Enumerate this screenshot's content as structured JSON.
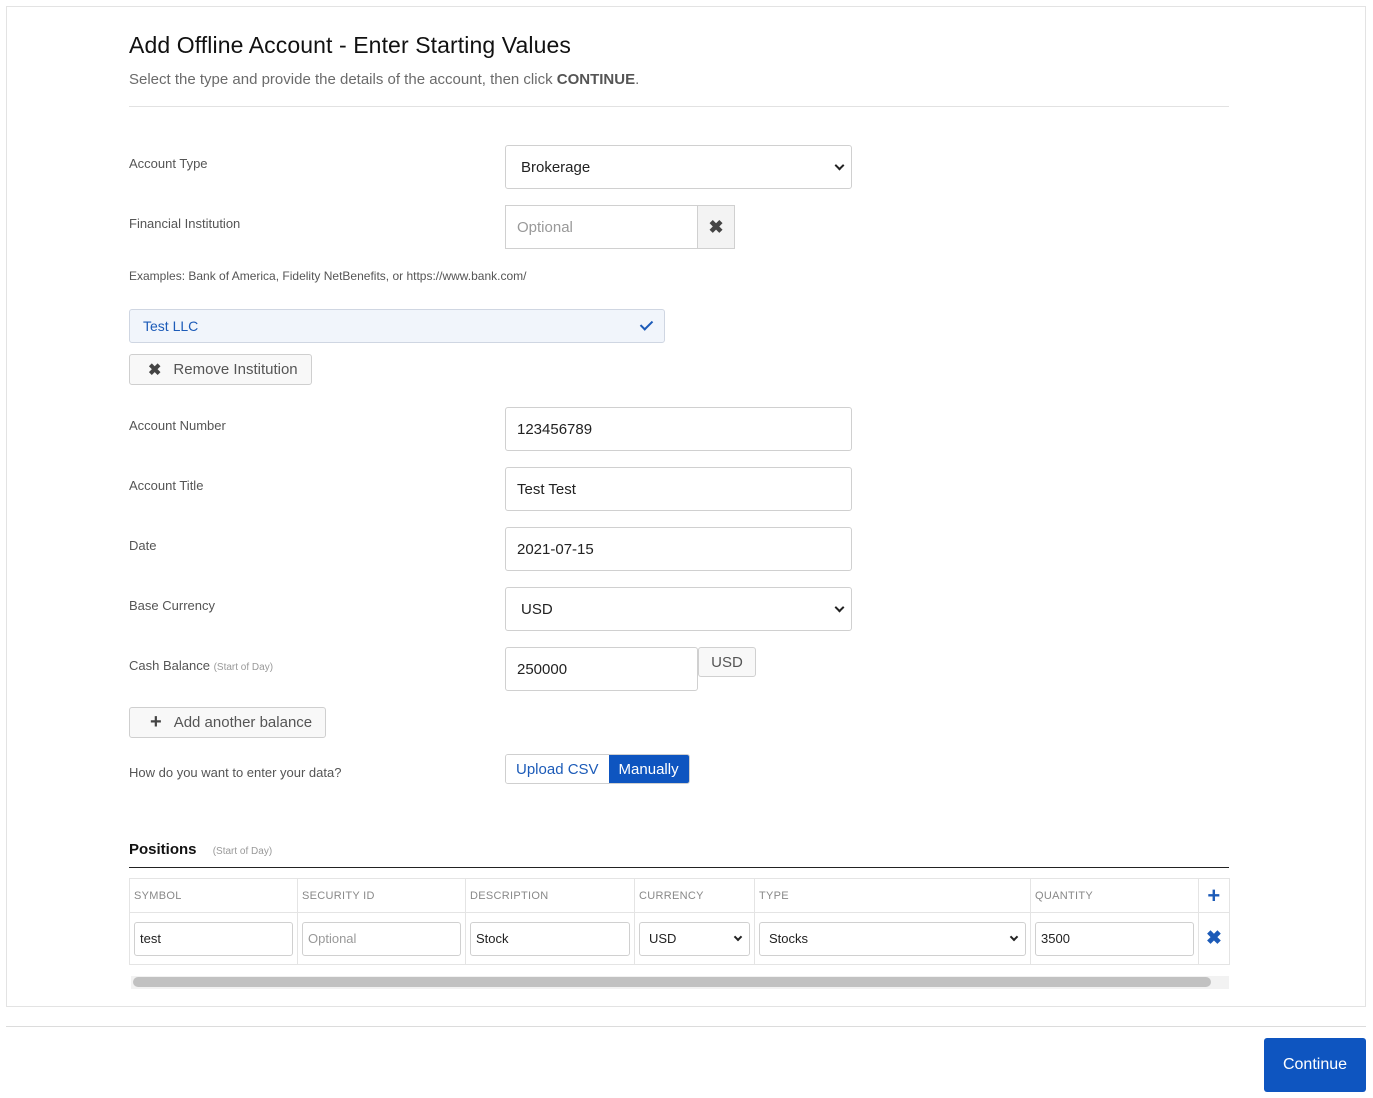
{
  "header": {
    "title": "Add Offline Account - Enter Starting Values",
    "subtitle_prefix": "Select the type and provide the details of the account, then click ",
    "subtitle_emphasis": "CONTINUE",
    "subtitle_suffix": "."
  },
  "form": {
    "account_type": {
      "label": "Account Type",
      "value": "Brokerage"
    },
    "financial_institution": {
      "label": "Financial Institution",
      "placeholder": "Optional",
      "value": "",
      "clear_icon": "close-icon",
      "examples": "Examples: Bank of America, Fidelity NetBenefits, or https://www.bank.com/",
      "selected": "Test LLC",
      "selected_icon": "check-icon",
      "remove_label": "Remove Institution"
    },
    "account_number": {
      "label": "Account Number",
      "value": "123456789"
    },
    "account_title": {
      "label": "Account Title",
      "value": "Test Test"
    },
    "date": {
      "label": "Date",
      "value": "2021-07-15"
    },
    "base_currency": {
      "label": "Base Currency",
      "value": "USD"
    },
    "cash_balance": {
      "label": "Cash Balance",
      "note": "(Start of Day)",
      "value": "250000",
      "currency": "USD"
    },
    "add_balance_label": "Add another balance",
    "entry_method": {
      "label": "How do you want to enter your data?",
      "options": [
        "Upload CSV",
        "Manually"
      ],
      "selected": "Manually"
    }
  },
  "positions": {
    "title": "Positions",
    "note": "(Start of Day)",
    "columns": [
      "SYMBOL",
      "SECURITY ID",
      "DESCRIPTION",
      "CURRENCY",
      "TYPE",
      "QUANTITY"
    ],
    "add_icon": "plus-icon",
    "rows": [
      {
        "symbol": "test",
        "security_id": "",
        "security_id_placeholder": "Optional",
        "description": "Stock",
        "currency": "USD",
        "type": "Stocks",
        "quantity": "3500",
        "remove_icon": "close-icon"
      }
    ]
  },
  "footer": {
    "continue_label": "Continue"
  },
  "colors": {
    "primary": "#0e55c0",
    "link": "#1c5bb8",
    "chip_bg": "#f1f5fb"
  }
}
